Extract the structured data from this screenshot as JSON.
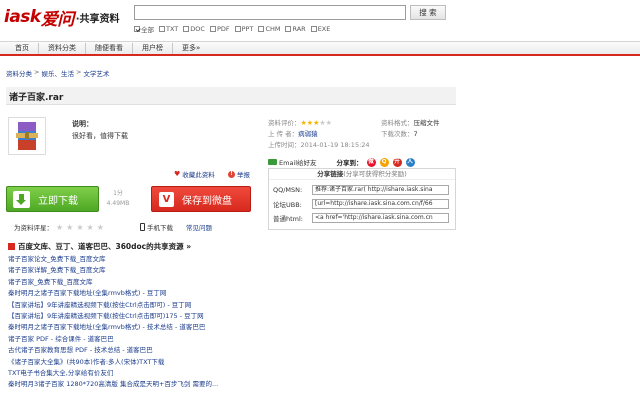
{
  "header": {
    "logo_brand": "iask",
    "logo_sina": "爱问",
    "logo_sub": "·共享资料",
    "search_placeholder": "",
    "search_button": "搜 索",
    "filters": [
      "全部",
      "TXT",
      "DOC",
      "PDF",
      "PPT",
      "CHM",
      "RAR",
      "EXE"
    ]
  },
  "nav": {
    "items": [
      "首页",
      "资料分类",
      "随便看看",
      "用户榜",
      "更多»"
    ]
  },
  "breadcrumb": [
    "资料分类",
    "娱乐、生活",
    "文学艺术"
  ],
  "file": {
    "title": "诸子百家.rar",
    "desc_label": "说明：",
    "desc_text": "很好看，值得下载",
    "fav": "收藏此资料",
    "report": "举报",
    "download_label": "立即下载",
    "points_label": "1分",
    "size": "4.49MB",
    "save_label": "保存到微盘",
    "rate_label": "为资料评星：",
    "app_download": "手机下载",
    "faq": "常见问题"
  },
  "meta": {
    "rating_label": "资料评价：",
    "rating": 2.5,
    "rating_max": 5,
    "format_label": "资料格式：",
    "format": "压缩文件",
    "uploader_label": "上 传 者：",
    "uploader": "病弱猿",
    "downloads_label": "下载次数：",
    "downloads": "7",
    "upload_time_label": "上传时间：",
    "upload_time": "2014-01-19 18:15:24"
  },
  "share": {
    "email": "Email给好友",
    "label": "分享到：",
    "services": [
      {
        "name": "weibo",
        "color": "#e6162d",
        "glyph": "微"
      },
      {
        "name": "qzone",
        "color": "#f5a100",
        "glyph": "Q"
      },
      {
        "name": "renren",
        "color": "#d6281f",
        "glyph": "开"
      },
      {
        "name": "tencent-weibo",
        "color": "#2d7fc8",
        "glyph": "人"
      }
    ],
    "box_title": "分享链接",
    "box_subtitle": "(分享可获得积分奖励)",
    "rows": [
      {
        "label": "QQ/MSN:",
        "value": "推荐:诸子百家.rar( http://ishare.iask.sina"
      },
      {
        "label": "论坛UBB:",
        "value": "[url=http://ishare.iask.sina.com.cn/f/66"
      },
      {
        "label": "普通html:",
        "value": "<a href='http://ishare.iask.sina.com.cn"
      }
    ]
  },
  "related": {
    "heading": "百度文库、豆丁、道客巴巴、360doc的共享资源 »",
    "links": [
      "诸子百家论文_免费下载_百度文库",
      "诸子百家详解_免费下载_百度文库",
      "诸子百家_免费下载_百度文库",
      "秦时明月之诸子百家下载地址(全集rmvb格式) - 豆丁网",
      "【百家讲坛】9年讲座精选视频下载(按住Ctrl点击即可) - 豆丁网",
      "【百家讲坛】9年讲座精选视频下载(按住Ctrl点击即可)175 - 豆丁网",
      "秦时明月之诸子百家下载地址(全集rmvb格式) - 技术总结 - 道客巴巴",
      "诸子百家 PDF - 综合课件 - 道客巴巴",
      "古代诸子百家教育思想 PDF - 技术总结 - 道客巴巴",
      "《诸子百家大全集》(共90本)作者:多人(宋体)TXT下载",
      "TXT电子书合集大全,分享给有价友们",
      "秦时明月3诸子百家 1280*720高清版 集合成是天明+百步飞剑 需要的..."
    ]
  }
}
